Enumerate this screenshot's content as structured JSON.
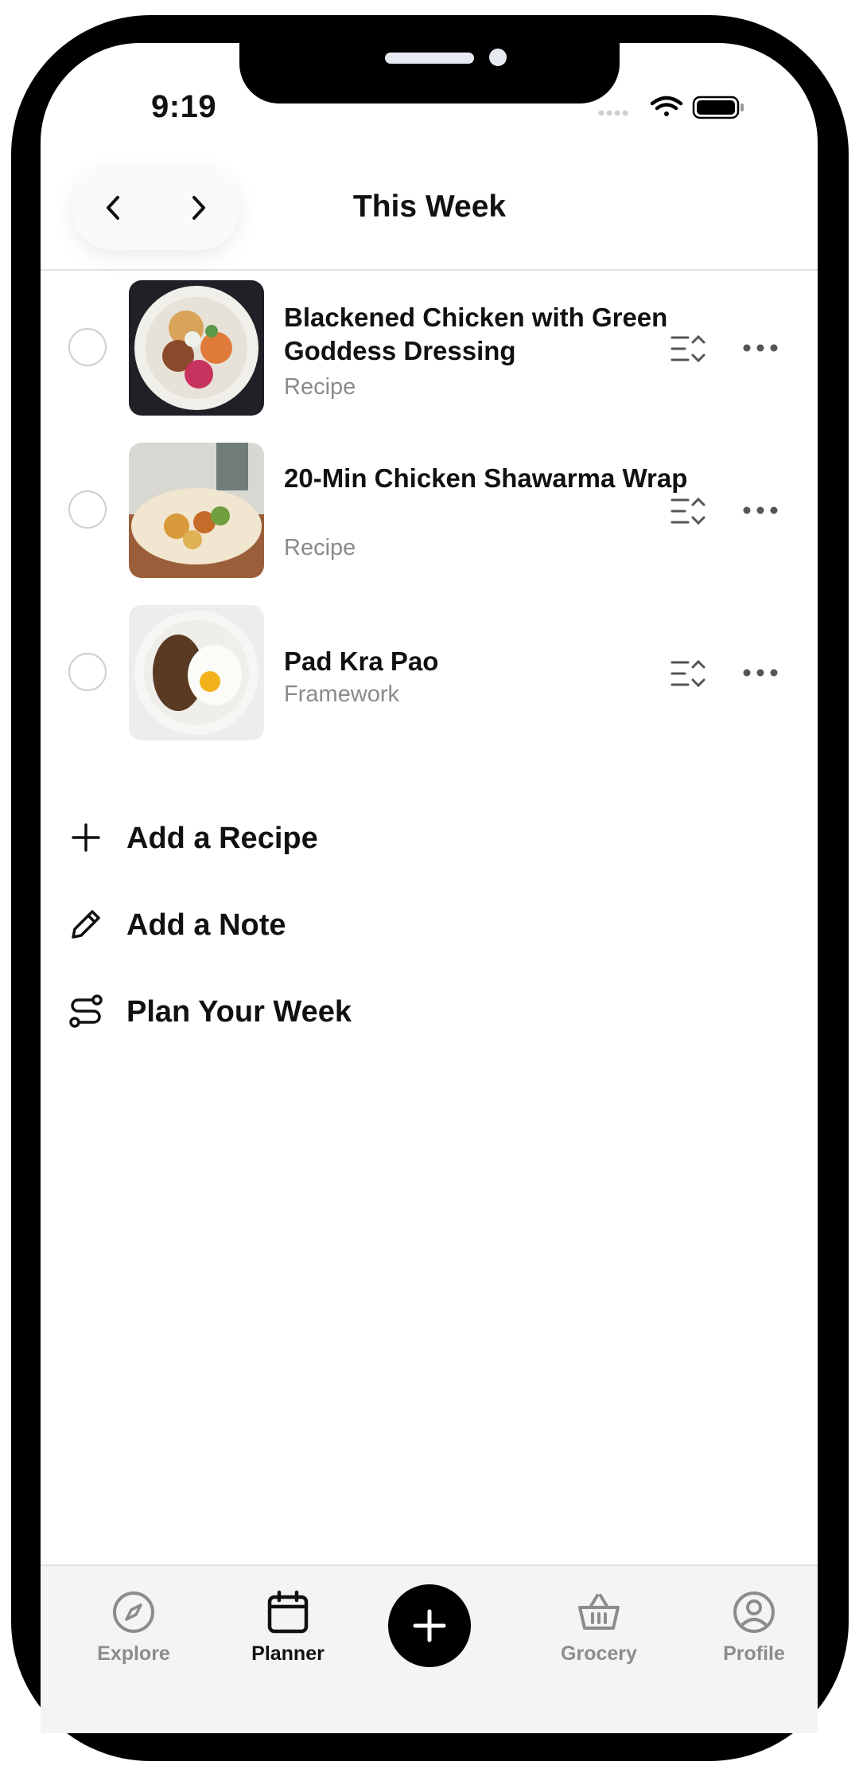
{
  "status_bar": {
    "time": "9:19"
  },
  "header": {
    "title": "This Week"
  },
  "recipes": [
    {
      "title": "Blackened Chicken with Green Goddess Dressing",
      "type": "Recipe",
      "image": "salad-bowl"
    },
    {
      "title": "20-Min Chicken Shawarma Wrap",
      "type": "Recipe",
      "image": "shawarma-wrap"
    },
    {
      "title": "Pad Kra Pao",
      "type": "Framework",
      "image": "rice-plate"
    }
  ],
  "actions": {
    "add_recipe": "Add a Recipe",
    "add_note": "Add a Note",
    "plan_week": "Plan Your Week"
  },
  "tabs": {
    "explore": "Explore",
    "planner": "Planner",
    "grocery": "Grocery",
    "profile": "Profile",
    "active": "planner"
  },
  "colors": {
    "accent": "#000000",
    "muted_text": "#8a8a8a",
    "tab_inactive": "#8c8c8c"
  }
}
